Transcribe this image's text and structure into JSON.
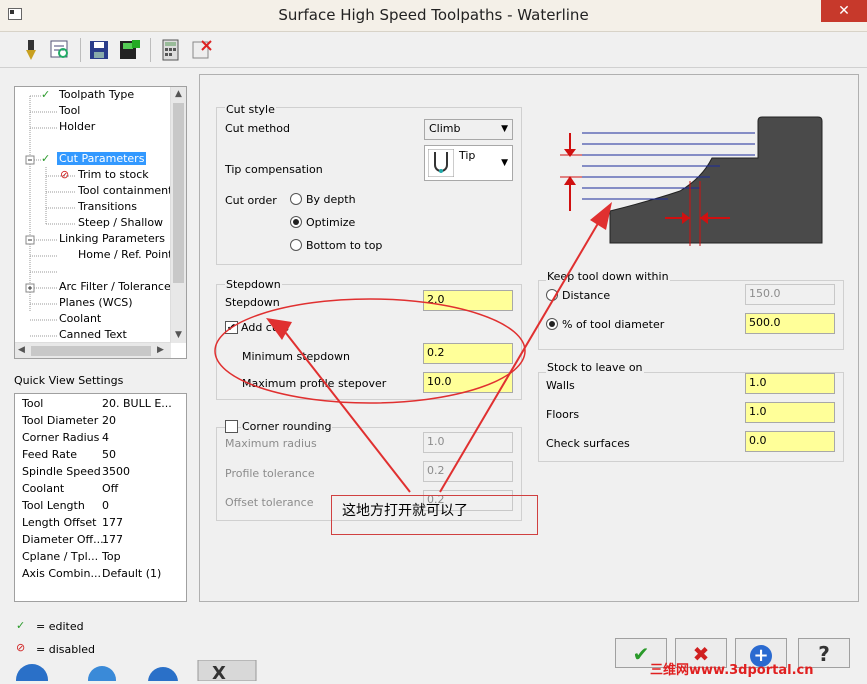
{
  "window": {
    "title": "Surface High Speed Toolpaths - Waterline",
    "close_label": "✕"
  },
  "toolbar": {
    "icons": [
      "tool-icon",
      "preview-icon",
      "save-icon",
      "save-as-icon",
      "calculator-icon",
      "delete-icon"
    ]
  },
  "tree": {
    "items": [
      {
        "label": "Toolpath Type",
        "check": true
      },
      {
        "label": "Tool",
        "check": false
      },
      {
        "label": "Holder",
        "check": false
      },
      {
        "label": "Cut Parameters",
        "check": true,
        "selected": true
      },
      {
        "label": "Trim to stock",
        "disabled": true
      },
      {
        "label": "Tool containment"
      },
      {
        "label": "Transitions"
      },
      {
        "label": "Steep / Shallow"
      },
      {
        "label": "Linking Parameters"
      },
      {
        "label": "Home / Ref. Points"
      },
      {
        "label": "Arc Filter / Tolerance"
      },
      {
        "label": "Planes (WCS)"
      },
      {
        "label": "Coolant"
      },
      {
        "label": "Canned Text"
      }
    ]
  },
  "quick_view": {
    "title": "Quick View Settings",
    "rows": [
      {
        "key": "Tool",
        "value": "20. BULL E..."
      },
      {
        "key": "Tool Diameter",
        "value": "20"
      },
      {
        "key": "Corner Radius",
        "value": "4"
      },
      {
        "key": "Feed Rate",
        "value": "50"
      },
      {
        "key": "Spindle Speed",
        "value": "3500"
      },
      {
        "key": "Coolant",
        "value": "Off"
      },
      {
        "key": "Tool Length",
        "value": "0"
      },
      {
        "key": "Length Offset",
        "value": "177"
      },
      {
        "key": "Diameter Off...",
        "value": "177"
      },
      {
        "key": "Cplane / Tpl...",
        "value": "Top"
      },
      {
        "key": "Axis Combin...",
        "value": "Default (1)"
      }
    ]
  },
  "legend": {
    "edited": "= edited",
    "disabled": "= disabled"
  },
  "cut_style": {
    "title": "Cut style",
    "cut_method_label": "Cut method",
    "cut_method_value": "Climb",
    "tip_comp_label": "Tip compensation",
    "tip_comp_value": "Tip",
    "cut_order_label": "Cut order",
    "cut_order_options": [
      "By depth",
      "Optimize",
      "Bottom to top"
    ],
    "cut_order_selected": 1
  },
  "stepdown": {
    "title": "Stepdown",
    "stepdown_label": "Stepdown",
    "stepdown_value": "2.0",
    "add_cuts_label": "Add cuts",
    "add_cuts_checked": true,
    "min_stepdown_label": "Minimum stepdown",
    "min_stepdown_value": "0.2",
    "max_profile_label": "Maximum profile stepover",
    "max_profile_value": "10.0"
  },
  "corner_rounding": {
    "label": "Corner rounding",
    "max_radius_label": "Maximum radius",
    "max_radius_value": "1.0",
    "profile_tol_label": "Profile tolerance",
    "profile_tol_value": "0.2",
    "offset_tol_label": "Offset tolerance",
    "offset_tol_value": "0.2"
  },
  "keep_tool_down": {
    "title": "Keep tool down within",
    "distance_label": "Distance",
    "distance_value": "150.0",
    "percent_label": "% of tool diameter",
    "percent_value": "500.0",
    "selected": 1
  },
  "stock": {
    "title": "Stock to leave on",
    "walls_label": "Walls",
    "walls_value": "1.0",
    "floors_label": "Floors",
    "floors_value": "1.0",
    "check_label": "Check surfaces",
    "check_value": "0.0"
  },
  "buttons": {
    "ok": "✔",
    "cancel": "✖",
    "add": "+",
    "help": "?"
  },
  "annotation": {
    "text": "这地方打开就可以了"
  },
  "watermark": {
    "text": "三维网www.3dportal.cn"
  },
  "colors": {
    "highlight": "#ffff99",
    "selection": "#3399ff",
    "annotation": "#e03030"
  }
}
